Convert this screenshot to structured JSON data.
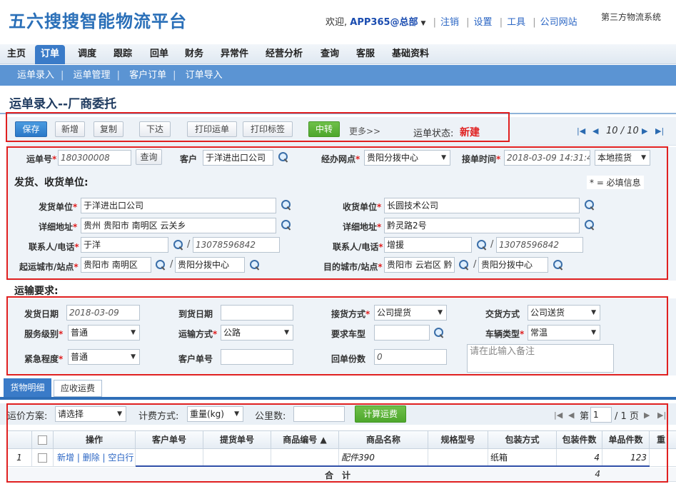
{
  "header": {
    "logo": "五六搜搜智能物流平台",
    "welcome": "欢迎,",
    "org": "APP365@总部",
    "links": [
      "注销",
      "设置",
      "工具",
      "公司网站"
    ],
    "system": "第三方物流系统"
  },
  "nav": {
    "items": [
      "主页",
      "订单",
      "调度",
      "跟踪",
      "回单",
      "财务",
      "异常件",
      "经营分析",
      "查询",
      "客服",
      "基础资料"
    ],
    "active": "订单"
  },
  "subnav": {
    "items": [
      "运单录入",
      "运单管理",
      "客户订单",
      "订单导入"
    ]
  },
  "page": {
    "title": "运单录入--厂商委托"
  },
  "toolbar": {
    "save": "保存",
    "add": "新增",
    "copy": "复制",
    "issue": "下达",
    "print_waybill": "打印运单",
    "print_label": "打印标签",
    "transfer": "中转",
    "more": "更多>>",
    "status_label": "运单状态:",
    "status_value": "新建",
    "pager": "10 / 10"
  },
  "order": {
    "waybill_label": "运单号",
    "waybill_no": "180300008",
    "query": "查询",
    "customer_label": "客户",
    "customer": "于洋进出口公司",
    "branch_label": "经办网点",
    "branch": "贵阳分拨中心",
    "time_label": "接单时间",
    "time": "2018-03-09 14:31:47",
    "pickup": "本地揽货"
  },
  "party": {
    "section": "发货、收货单位:",
    "required_note": "* = 必填信息",
    "sender_label": "发货单位",
    "sender": "于洋进出口公司",
    "sender_addr_label": "详细地址",
    "sender_addr": "贵州 贵阳市 南明区 云关乡",
    "sender_contact_label": "联系人/电话",
    "sender_contact": "于洋",
    "sender_phone": "13078596842",
    "origin_label": "起运城市/站点",
    "origin_city": "贵阳市 南明区",
    "origin_station": "贵阳分拨中心",
    "receiver_label": "收货单位",
    "receiver": "长圆技术公司",
    "receiver_addr_label": "详细地址",
    "receiver_addr": "黔灵路2号",
    "receiver_contact_label": "联系人/电话",
    "receiver_contact": "增援",
    "receiver_phone": "13078596842",
    "dest_label": "目的城市/站点",
    "dest_city": "贵阳市 云岩区 黔",
    "dest_station": "贵阳分拨中心"
  },
  "transport": {
    "section": "运输要求:",
    "ship_date_label": "发货日期",
    "ship_date": "2018-03-09",
    "arrive_date_label": "到货日期",
    "arrive_date": "",
    "pickup_mode_label": "接货方式",
    "pickup_mode": "公司提货",
    "delivery_mode_label": "交货方式",
    "delivery_mode": "公司送货",
    "service_label": "服务级别",
    "service": "普通",
    "transport_label": "运输方式",
    "transport_mode": "公路",
    "vehicle_req_label": "要求车型",
    "vehicle_req": "",
    "vehicle_type_label": "车辆类型",
    "vehicle_type": "常温",
    "urgency_label": "紧急程度",
    "urgency": "普通",
    "customer_no_label": "客户单号",
    "customer_no": "",
    "receipt_count_label": "回单份数",
    "receipt_count": "0",
    "remark_placeholder": "请在此输入备注"
  },
  "tabs": [
    "货物明细",
    "应收运费"
  ],
  "grid_toolbar": {
    "plan_label": "运价方案:",
    "plan": "请选择",
    "calc_label": "计费方式:",
    "calc": "重量(kg)",
    "km_label": "公里数:",
    "km": "",
    "calc_button": "计算运费",
    "page_prefix": "第",
    "page": "1",
    "page_suffix": "/ 1 页"
  },
  "grid": {
    "headers": [
      "操作",
      "客户单号",
      "提货单号",
      "商品编号 ▲",
      "商品名称",
      "规格型号",
      "包装方式",
      "包装件数",
      "单品件数",
      "重"
    ],
    "row": {
      "index": "1",
      "ops": [
        "新增",
        "删除",
        "空白行"
      ],
      "customer_no": "",
      "pickup_no": "",
      "sku": "",
      "name": "配件390",
      "spec": "",
      "package": "纸箱",
      "pkg_count": "4",
      "unit_count": "123"
    },
    "total_label": "合　计",
    "total_pkg": "4"
  }
}
